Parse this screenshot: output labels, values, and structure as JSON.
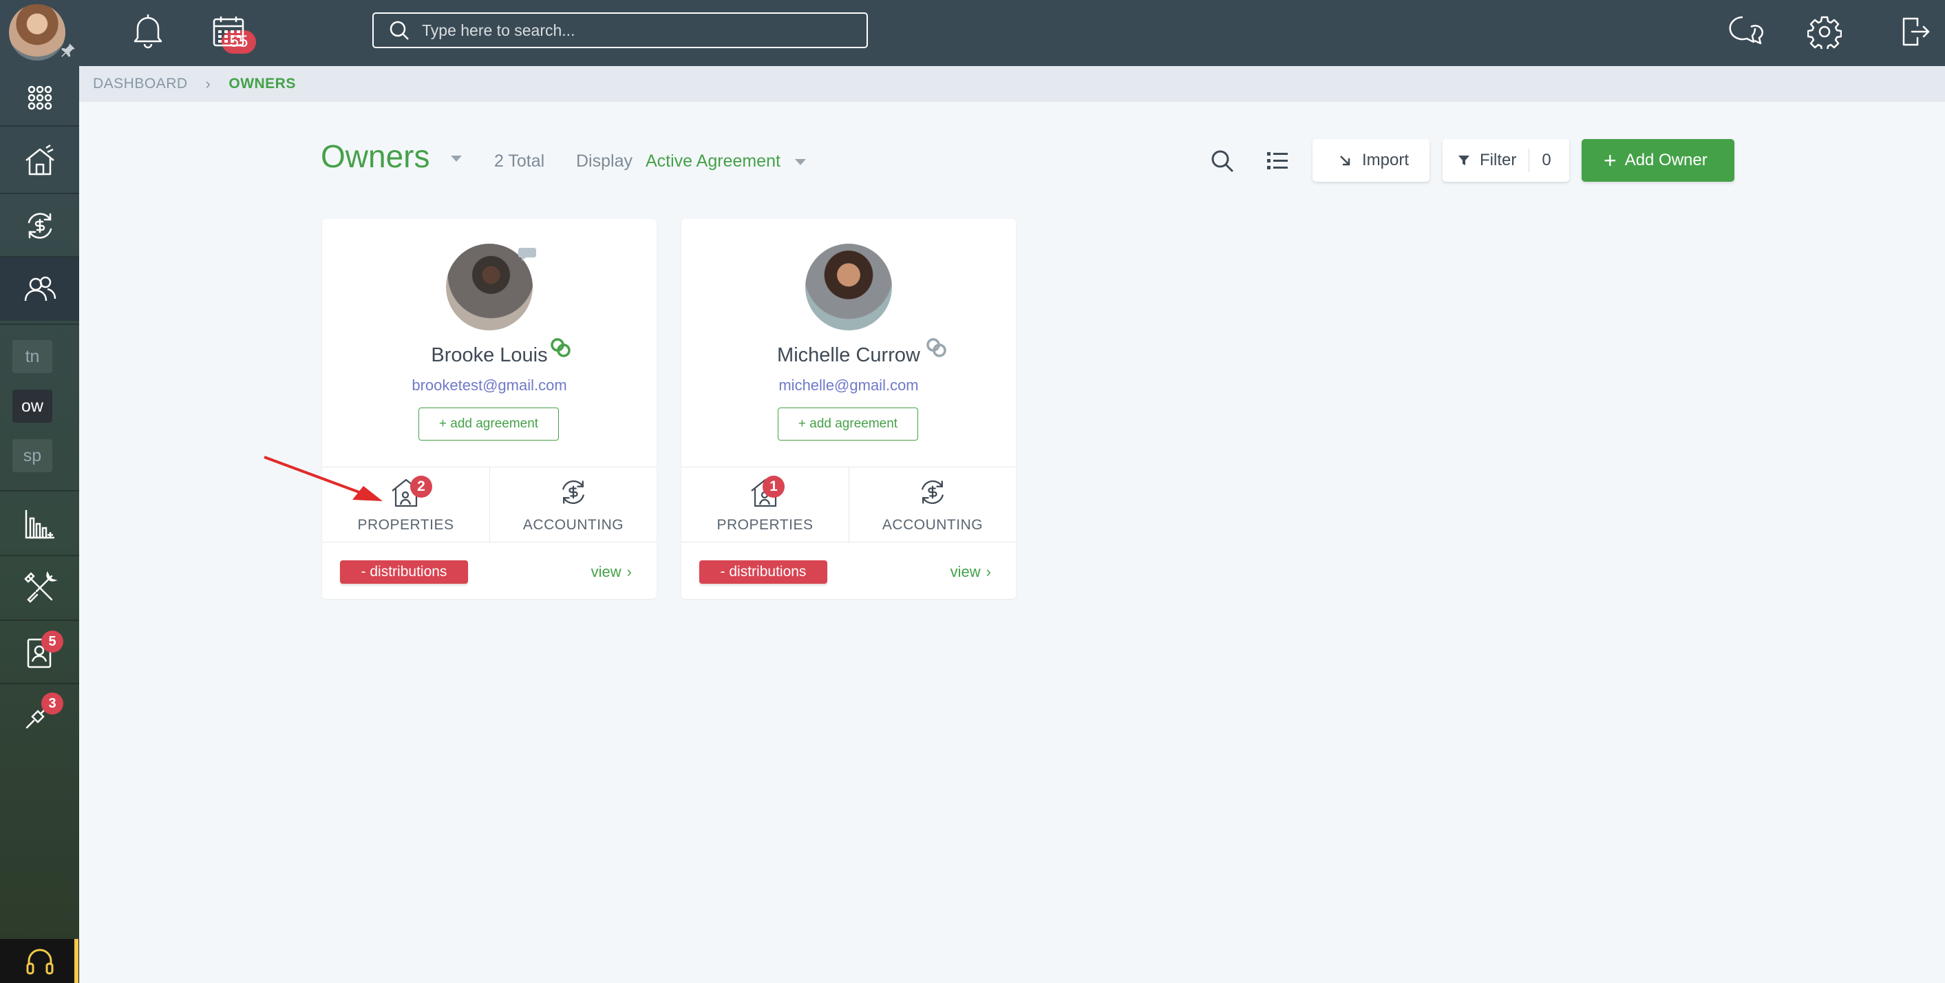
{
  "topbar": {
    "notifications_count": "55",
    "search_placeholder": "Type here to search..."
  },
  "sidebar": {
    "letters": [
      "tn",
      "ow",
      "sp"
    ],
    "badges": {
      "tenant_requests": "5",
      "maintenance": "3"
    }
  },
  "breadcrumb": {
    "root": "DASHBOARD",
    "current": "OWNERS"
  },
  "header": {
    "title": "Owners",
    "total": "2 Total",
    "display_label": "Display",
    "display_value": "Active Agreement",
    "import_label": "Import",
    "filter_label": "Filter",
    "filter_count": "0",
    "add_label": "Add Owner"
  },
  "owners": [
    {
      "name": "Brooke Louis",
      "email": "brooketest@gmail.com",
      "agreement_label": "+ add agreement",
      "properties_label": "PROPERTIES",
      "properties_count": "2",
      "accounting_label": "ACCOUNTING",
      "distributions_label": "- distributions",
      "view_label": "view"
    },
    {
      "name": "Michelle Currow",
      "email": "michelle@gmail.com",
      "agreement_label": "+ add agreement",
      "properties_label": "PROPERTIES",
      "properties_count": "1",
      "accounting_label": "ACCOUNTING",
      "distributions_label": "- distributions",
      "view_label": "view"
    }
  ],
  "colors": {
    "accent_green": "#45a149",
    "badge_red": "#d84451",
    "topbar": "#3a4a55"
  }
}
